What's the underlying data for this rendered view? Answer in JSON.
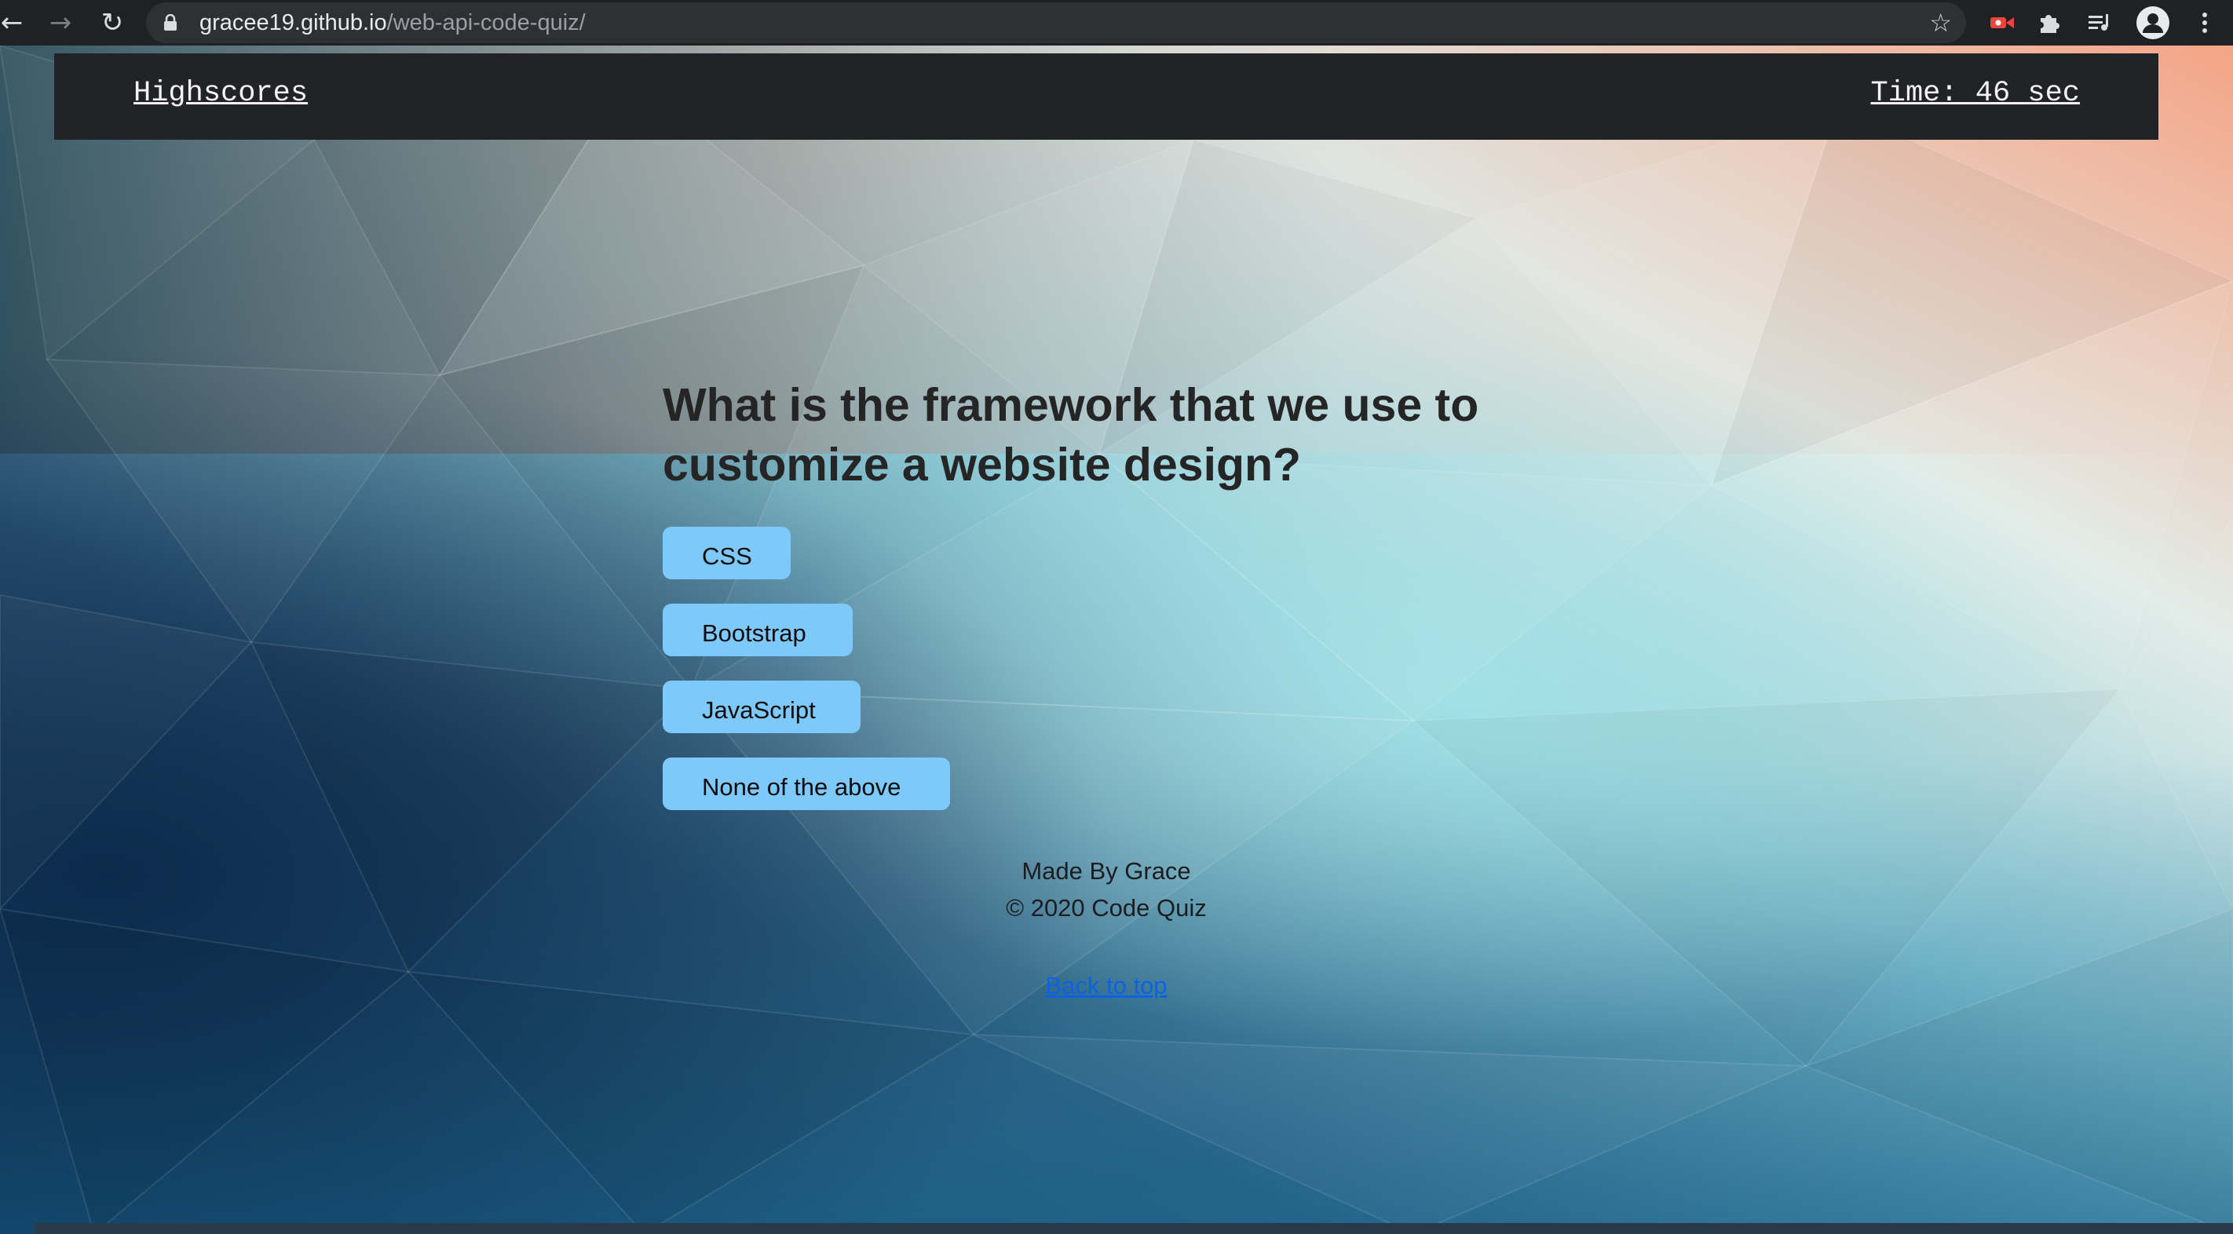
{
  "browser": {
    "url_host": "gracee19.github.io",
    "url_path": "/web-api-code-quiz/",
    "icons": [
      "back-icon",
      "forward-icon",
      "reload-icon",
      "lock-icon",
      "star-icon",
      "screen-record-extension-icon",
      "extensions-puzzle-icon",
      "reading-list-icon",
      "profile-icon",
      "menu-kebab-icon"
    ]
  },
  "header": {
    "highscores_label": "Highscores",
    "timer_label": "Time: 46 sec"
  },
  "quiz": {
    "question": "What is the framework that we use to customize a website design?",
    "answers": [
      "CSS",
      "Bootstrap",
      "JavaScript",
      "None of the above"
    ]
  },
  "footer": {
    "made_by": "Made By Grace",
    "copyright": "© 2020 Code Quiz",
    "back_to_top": "Back to top"
  },
  "colors": {
    "answer_button": "#7ec9fb",
    "header_bg": "#212327",
    "link": "#0a62e6"
  }
}
